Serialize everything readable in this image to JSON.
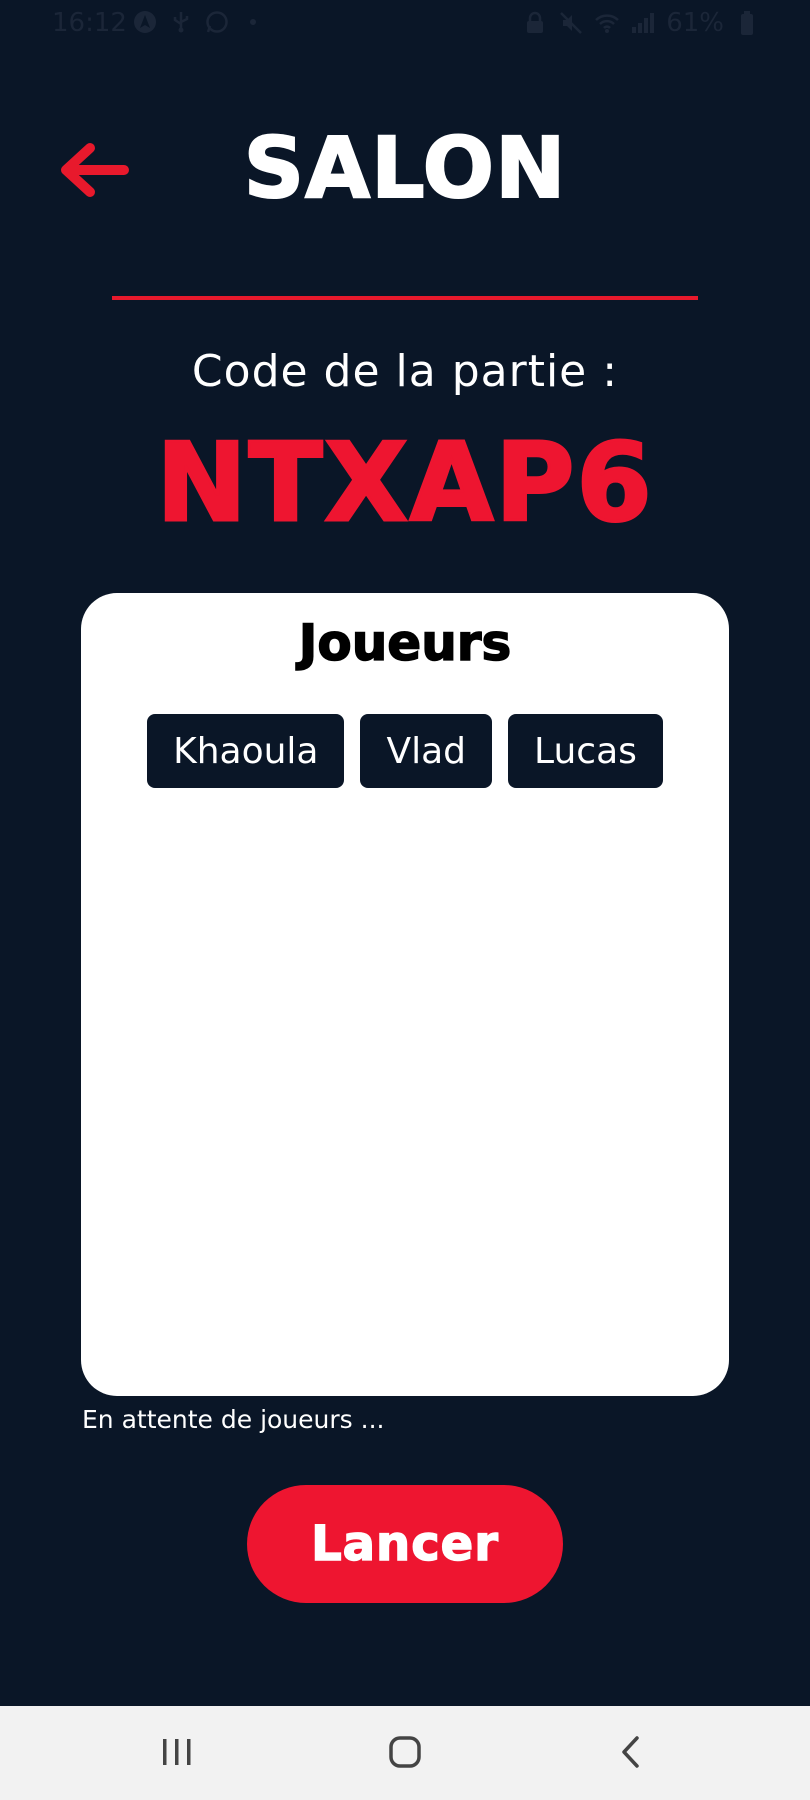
{
  "status_bar": {
    "time": "16:12",
    "battery": "61%",
    "left_icons": [
      "android-auto-icon",
      "usb-icon",
      "whatsapp-icon",
      "dot-icon"
    ],
    "right_icons": [
      "lock-icon",
      "mute-icon",
      "wifi-icon",
      "signal-icon",
      "battery-icon"
    ]
  },
  "header": {
    "title": "SALON",
    "back_icon": "arrow-left-icon"
  },
  "game": {
    "code_label": "Code de la partie :",
    "code": "NTXAP6"
  },
  "players": {
    "title": "Joueurs",
    "list": [
      "Khaoula",
      "Vlad",
      "Lucas"
    ]
  },
  "waiting_text": "En attente de joueurs ...",
  "launch_button": "Lancer",
  "nav_bar": {
    "buttons": [
      "recent-apps-icon",
      "home-icon",
      "back-icon"
    ]
  },
  "colors": {
    "background": "#0a1627",
    "accent": "#ee1530",
    "card": "#ffffff",
    "chip": "#0a1627"
  }
}
